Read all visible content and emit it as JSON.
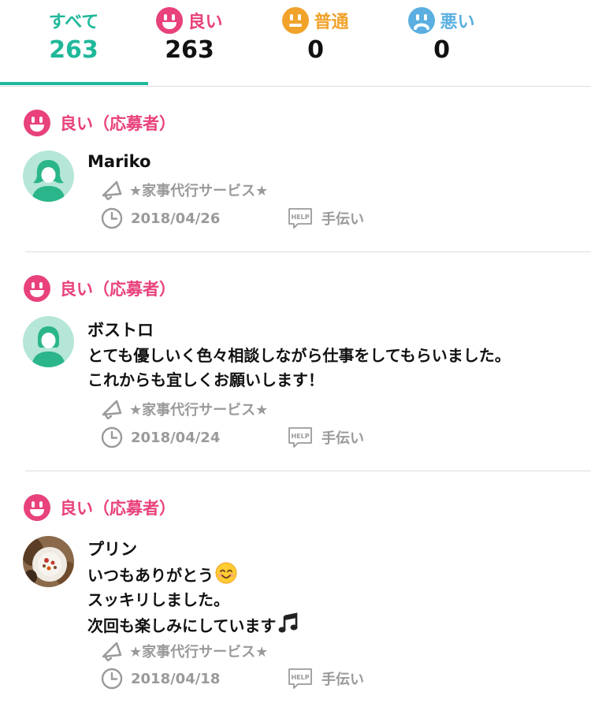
{
  "tabs": [
    {
      "label": "すべて",
      "count": "263",
      "color": "#1fb89a",
      "icon": null,
      "active": true
    },
    {
      "label": "良い",
      "count": "263",
      "color": "#e8417c",
      "icon": "smile-face-icon",
      "active": false
    },
    {
      "label": "普通",
      "count": "0",
      "color": "#f0a22a",
      "icon": "neutral-face-icon",
      "active": false
    },
    {
      "label": "悪い",
      "count": "0",
      "color": "#5aafe0",
      "icon": "sad-face-icon",
      "active": false
    }
  ],
  "reviews": [
    {
      "rating_label": "良い（応募者）",
      "name": "Mariko",
      "comment_lines": [],
      "service": "★家事代行サービス★",
      "date": "2018/04/26",
      "category": "手伝い",
      "avatar": "default-user-avatar"
    },
    {
      "rating_label": "良い（応募者）",
      "name": "ボストロ",
      "comment_lines": [
        "とても優しいく色々相談しながら仕事をしてもらいました。",
        "これからも宜しくお願いします！"
      ],
      "service": "★家事代行サービス★",
      "date": "2018/04/24",
      "category": "手伝い",
      "avatar": "default-user-avatar"
    },
    {
      "rating_label": "良い（応募者）",
      "name": "プリン",
      "comment_lines": [
        "いつもありがとう",
        "スッキリしました。",
        "次回も楽しみにしています"
      ],
      "comment_emojis": [
        "smiling-face-emoji",
        "music-note-emoji"
      ],
      "service": "★家事代行サービス★",
      "date": "2018/04/18",
      "category": "手伝い",
      "avatar": "photo-avatar"
    }
  ],
  "colors": {
    "accent": "#1fb89a",
    "good": "#e8417c",
    "normal": "#f0a22a",
    "bad": "#5aafe0",
    "meta_gray": "#9a9a9a",
    "avatar_bg": "#b5e6d8",
    "avatar_fg": "#2bb58a"
  }
}
